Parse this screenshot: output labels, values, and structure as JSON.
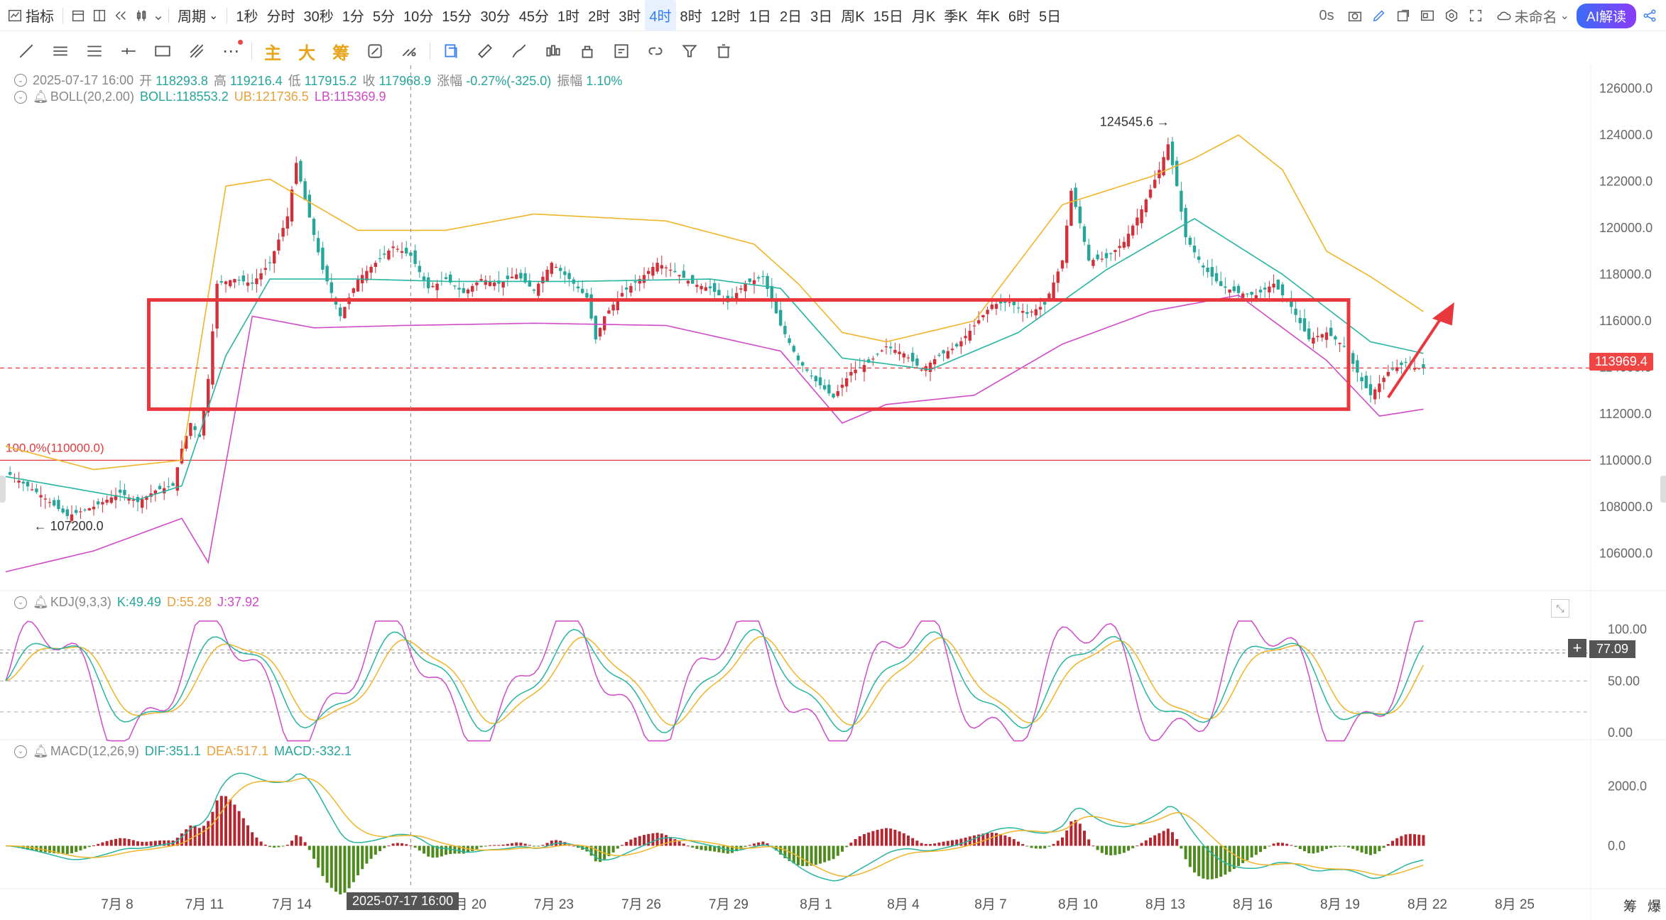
{
  "toolbar": {
    "indicator_label": "指标",
    "period_label": "周期",
    "periods": [
      "1秒",
      "分时",
      "30秒",
      "1分",
      "5分",
      "10分",
      "15分",
      "30分",
      "45分",
      "1时",
      "2时",
      "3时",
      "4时",
      "8时",
      "12时",
      "1日",
      "2日",
      "3日",
      "周K",
      "15日",
      "月K",
      "季K",
      "年K",
      "6时",
      "5日"
    ],
    "active_period": "4时",
    "latency": "0s",
    "layout_name": "未命名",
    "ai_button": "AI解读"
  },
  "drawing_tools": {
    "main_label": "主",
    "big_label": "大",
    "chip_label": "筹"
  },
  "legend": {
    "time": "2025-07-17 16:00",
    "open_label": "开",
    "open": "118293.8",
    "high_label": "高",
    "high": "119216.4",
    "low_label": "低",
    "low": "117915.2",
    "close_label": "收",
    "close": "117968.9",
    "change_label": "涨幅",
    "change": "-0.27%(-325.0)",
    "amp_label": "振幅",
    "amp": "1.10%",
    "boll_name": "BOLL(20,2.00)",
    "boll": "BOLL:118553.2",
    "ub": "UB:121736.5",
    "lb": "LB:115369.9",
    "kdj_name": "KDJ(9,3,3)",
    "k": "K:49.49",
    "d": "D:55.28",
    "j": "J:37.92",
    "macd_name": "MACD(12,26,9)",
    "dif": "DIF:351.1",
    "dea": "DEA:517.1",
    "macd": "MACD:-332.1"
  },
  "annotations": {
    "high_marker": "124545.6",
    "low_marker": "107200.0",
    "fib_label": "100.0%(110000.0)",
    "current_price": "113969.4",
    "kdj_current": "77.09",
    "crosshair_date": "2025-07-17 16:00"
  },
  "colors": {
    "up": "#d0313a",
    "down": "#26a69a",
    "boll_mid": "#26b5a0",
    "boll_upper": "#f0b429",
    "boll_lower": "#d04ac8",
    "box": "#e8383d"
  },
  "price_axis": [
    "126000.0",
    "124000.0",
    "122000.0",
    "120000.0",
    "118000.0",
    "116000.0",
    "114000.0",
    "112000.0",
    "110000.0",
    "108000.0",
    "106000.0"
  ],
  "kdj_axis": [
    "100.00",
    "50.00",
    "0.00"
  ],
  "macd_axis": [
    "2000.0",
    "0.0"
  ],
  "date_axis": [
    "7月 8",
    "7月 11",
    "7月 14",
    "7月 17",
    "7月 20",
    "7月 23",
    "7月 26",
    "7月 29",
    "8月 1",
    "8月 4",
    "8月 7",
    "8月 10",
    "8月 13",
    "8月 16",
    "8月 19",
    "8月 22",
    "8月 25"
  ],
  "bottom_right": {
    "chips": "筹",
    "burst": "爆"
  },
  "chart_data": {
    "type": "candlestick",
    "timeframe": "4时",
    "price_range": [
      105000,
      127000
    ],
    "close_path": [
      [
        0,
        109500
      ],
      [
        8,
        108500
      ],
      [
        14,
        107600
      ],
      [
        20,
        108000
      ],
      [
        26,
        108600
      ],
      [
        30,
        108200
      ],
      [
        34,
        108700
      ],
      [
        38,
        108900
      ],
      [
        40,
        110500
      ],
      [
        42,
        111600
      ],
      [
        44,
        111000
      ],
      [
        46,
        113500
      ],
      [
        48,
        117600
      ],
      [
        52,
        117800
      ],
      [
        56,
        117600
      ],
      [
        60,
        118500
      ],
      [
        64,
        120500
      ],
      [
        66,
        122800
      ],
      [
        68,
        121200
      ],
      [
        72,
        118200
      ],
      [
        76,
        116200
      ],
      [
        80,
        117800
      ],
      [
        84,
        118500
      ],
      [
        88,
        119200
      ],
      [
        92,
        118800
      ],
      [
        96,
        117400
      ],
      [
        100,
        117800
      ],
      [
        104,
        117200
      ],
      [
        108,
        117800
      ],
      [
        112,
        117600
      ],
      [
        116,
        118000
      ],
      [
        120,
        117300
      ],
      [
        124,
        118500
      ],
      [
        128,
        117800
      ],
      [
        132,
        117000
      ],
      [
        134,
        115200
      ],
      [
        136,
        116200
      ],
      [
        140,
        117200
      ],
      [
        144,
        117800
      ],
      [
        148,
        118500
      ],
      [
        152,
        118100
      ],
      [
        156,
        117600
      ],
      [
        160,
        117400
      ],
      [
        164,
        116800
      ],
      [
        168,
        117600
      ],
      [
        172,
        117900
      ],
      [
        176,
        115800
      ],
      [
        180,
        114300
      ],
      [
        184,
        113400
      ],
      [
        188,
        112700
      ],
      [
        192,
        113800
      ],
      [
        196,
        114200
      ],
      [
        200,
        114900
      ],
      [
        204,
        114600
      ],
      [
        208,
        113900
      ],
      [
        212,
        114500
      ],
      [
        216,
        114900
      ],
      [
        220,
        115800
      ],
      [
        224,
        116700
      ],
      [
        228,
        116800
      ],
      [
        232,
        116300
      ],
      [
        236,
        116700
      ],
      [
        240,
        118600
      ],
      [
        242,
        121600
      ],
      [
        244,
        120200
      ],
      [
        246,
        118600
      ],
      [
        250,
        118700
      ],
      [
        254,
        119400
      ],
      [
        258,
        120800
      ],
      [
        262,
        122500
      ],
      [
        264,
        123600
      ],
      [
        266,
        121800
      ],
      [
        268,
        119600
      ],
      [
        272,
        118300
      ],
      [
        276,
        117500
      ],
      [
        280,
        117200
      ],
      [
        284,
        117100
      ],
      [
        288,
        117600
      ],
      [
        292,
        116600
      ],
      [
        296,
        115200
      ],
      [
        300,
        115500
      ],
      [
        304,
        114900
      ],
      [
        308,
        113400
      ],
      [
        310,
        112800
      ],
      [
        314,
        113800
      ],
      [
        318,
        114200
      ],
      [
        320,
        113969.4
      ]
    ],
    "boll_upper": [
      [
        0,
        110600
      ],
      [
        20,
        109600
      ],
      [
        40,
        110000
      ],
      [
        50,
        121800
      ],
      [
        60,
        122100
      ],
      [
        80,
        119900
      ],
      [
        100,
        119900
      ],
      [
        120,
        120600
      ],
      [
        150,
        120300
      ],
      [
        170,
        119300
      ],
      [
        180,
        117600
      ],
      [
        190,
        115500
      ],
      [
        200,
        115100
      ],
      [
        220,
        116000
      ],
      [
        240,
        121000
      ],
      [
        260,
        122200
      ],
      [
        270,
        123000
      ],
      [
        280,
        124000
      ],
      [
        290,
        122500
      ],
      [
        300,
        119000
      ],
      [
        310,
        117900
      ],
      [
        322,
        116400
      ]
    ],
    "boll_mid": [
      [
        0,
        109300
      ],
      [
        30,
        108300
      ],
      [
        40,
        108900
      ],
      [
        50,
        114500
      ],
      [
        60,
        117800
      ],
      [
        80,
        117800
      ],
      [
        100,
        117700
      ],
      [
        130,
        117700
      ],
      [
        160,
        117800
      ],
      [
        176,
        117400
      ],
      [
        190,
        114400
      ],
      [
        210,
        113900
      ],
      [
        230,
        115500
      ],
      [
        250,
        118200
      ],
      [
        270,
        120400
      ],
      [
        290,
        118000
      ],
      [
        310,
        115100
      ],
      [
        322,
        114600
      ]
    ],
    "boll_lower": [
      [
        0,
        105200
      ],
      [
        20,
        106100
      ],
      [
        40,
        107500
      ],
      [
        46,
        105600
      ],
      [
        56,
        116200
      ],
      [
        70,
        115700
      ],
      [
        90,
        115800
      ],
      [
        120,
        115900
      ],
      [
        150,
        115800
      ],
      [
        176,
        114700
      ],
      [
        190,
        111600
      ],
      [
        200,
        112400
      ],
      [
        220,
        112800
      ],
      [
        240,
        115000
      ],
      [
        260,
        116400
      ],
      [
        280,
        117100
      ],
      [
        300,
        114300
      ],
      [
        312,
        111900
      ],
      [
        322,
        112200
      ]
    ],
    "fib_level": 110000,
    "box_range": [
      112200,
      116900
    ],
    "kdj_range": [
      0,
      110
    ],
    "macd_range": [
      -1200,
      2600
    ]
  }
}
